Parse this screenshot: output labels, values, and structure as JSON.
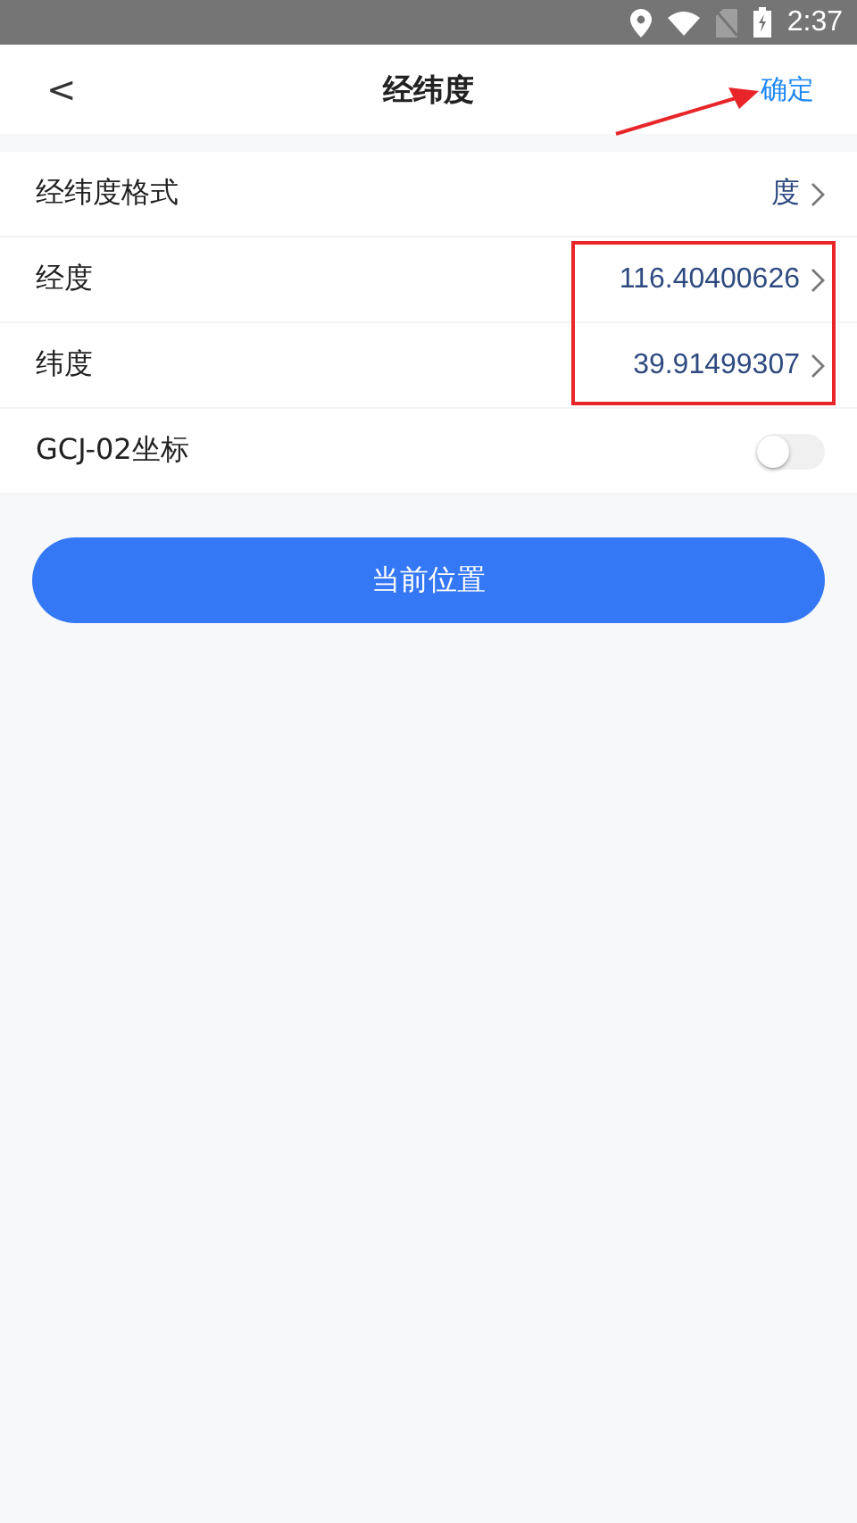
{
  "status_bar": {
    "time": "2:37"
  },
  "header": {
    "back": "<",
    "title": "经纬度",
    "action": "确定"
  },
  "rows": [
    {
      "kind": "nav",
      "label": "经纬度格式",
      "value": "度",
      "highlighted": false
    },
    {
      "kind": "nav",
      "label": "经度",
      "value": "116.40400626",
      "highlighted": true
    },
    {
      "kind": "nav",
      "label": "纬度",
      "value": "39.91499307",
      "highlighted": true
    },
    {
      "kind": "toggle",
      "label": "GCJ-02坐标",
      "on": false
    }
  ],
  "button": {
    "label": "当前位置"
  }
}
